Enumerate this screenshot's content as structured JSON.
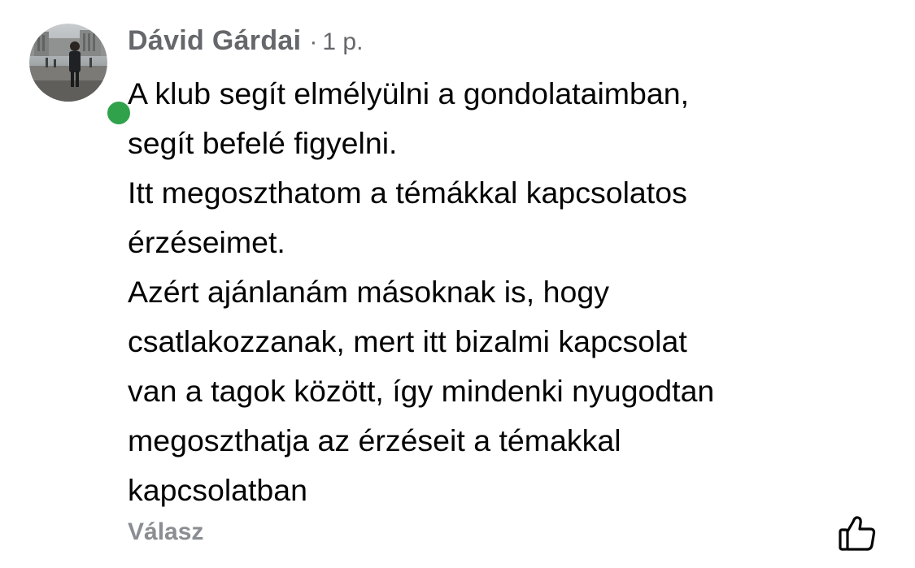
{
  "comment": {
    "author": "Dávid Gárdai",
    "separator": "·",
    "time": "1 p.",
    "lines": [
      "A klub segít elmélyülni a gondolataimban,",
      "segít befelé figyelni.",
      "Itt megoszthatom a témákkal kapcsolatos",
      "érzéseimet.",
      "Azért ajánlanám másoknak is, hogy",
      "csatlakozzanak, mert itt bizalmi kapcsolat",
      "van a tagok között, így mindenki nyugodtan",
      "megoszthatja az érzéseit a témakkal",
      "kapcsolatban"
    ],
    "reply_label": "Válasz",
    "online": true,
    "icons": {
      "like": "thumbs-up-icon"
    },
    "colors": {
      "meta_text": "#65676b",
      "reply_text": "#8a8d91",
      "online_dot": "#31a24c"
    }
  }
}
